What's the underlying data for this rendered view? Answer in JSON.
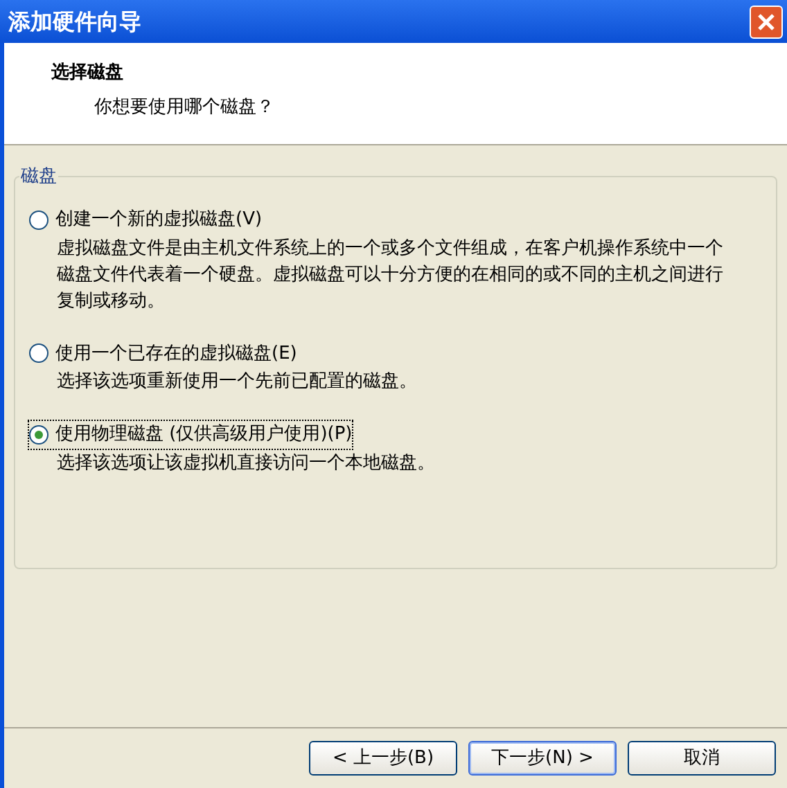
{
  "window": {
    "title": "添加硬件向导"
  },
  "header": {
    "title": "选择磁盘",
    "subtitle": "你想要使用哪个磁盘？"
  },
  "group": {
    "label": "磁盘",
    "options": [
      {
        "label": "创建一个新的虚拟磁盘(V)",
        "description": "虚拟磁盘文件是由主机文件系统上的一个或多个文件组成，在客户机操作系统中一个磁盘文件代表着一个硬盘。虚拟磁盘可以十分方便的在相同的或不同的主机之间进行复制或移动。",
        "selected": false
      },
      {
        "label": "使用一个已存在的虚拟磁盘(E)",
        "description": "选择该选项重新使用一个先前已配置的磁盘。",
        "selected": false
      },
      {
        "label": "使用物理磁盘 (仅供高级用户使用)(P)",
        "description": "选择该选项让该虚拟机直接访问一个本地磁盘。",
        "selected": true
      }
    ]
  },
  "buttons": [
    {
      "label": "< 上一步(B)",
      "focused": false
    },
    {
      "label": "下一步(N) >",
      "focused": true
    },
    {
      "label": "取消",
      "focused": false
    }
  ]
}
